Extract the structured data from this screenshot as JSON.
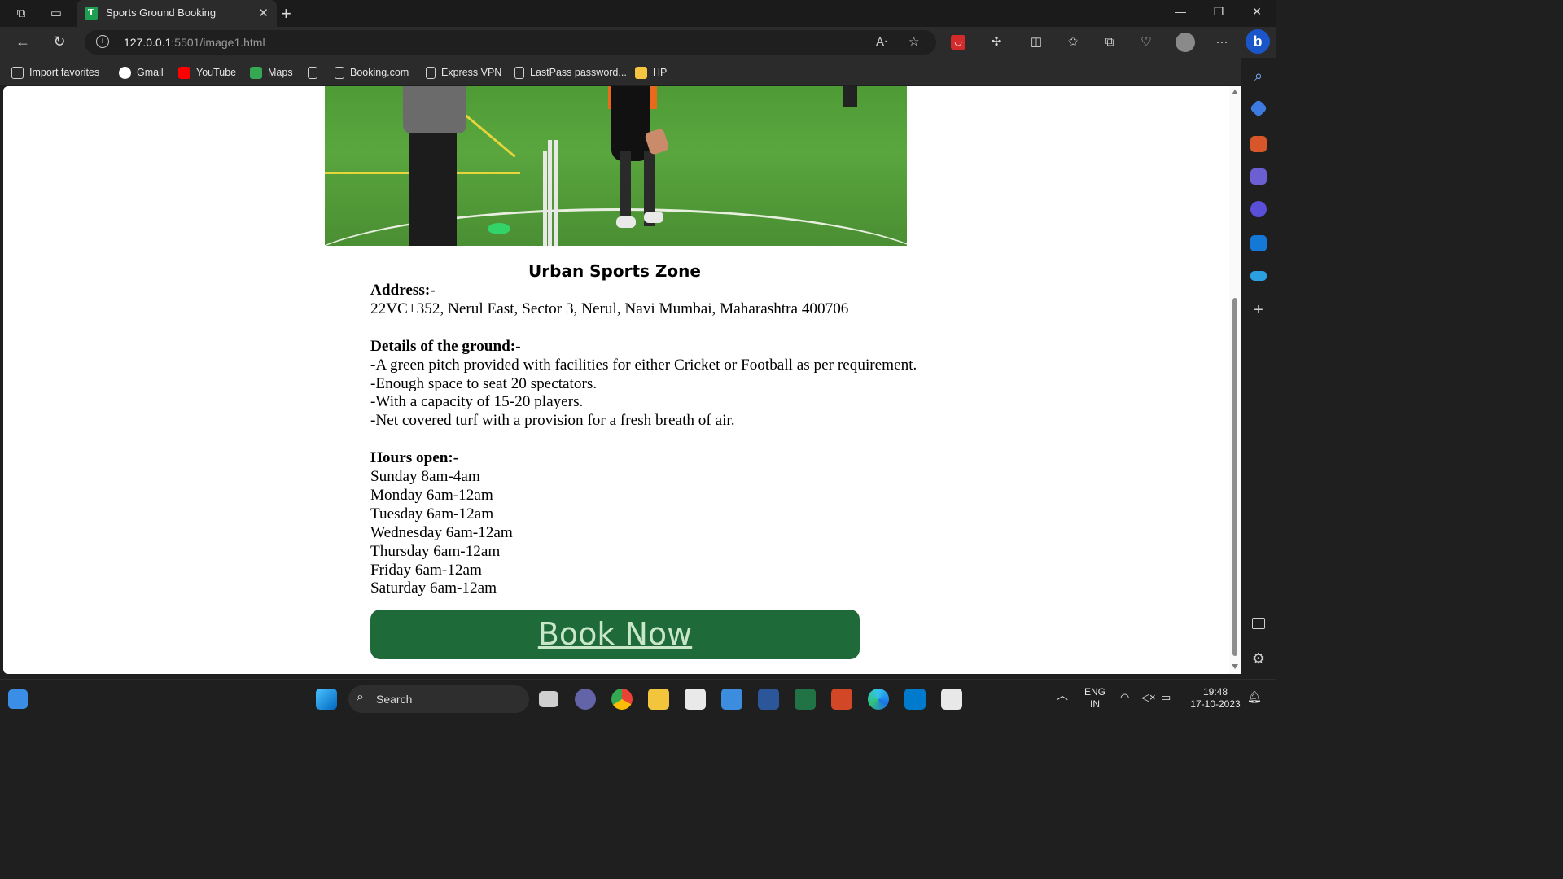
{
  "browser": {
    "tab_title": "Sports Ground Booking",
    "tab_favicon_letter": "T",
    "url_host": "127.0.0.1",
    "url_path": ":5501/image1.html"
  },
  "favorites": [
    {
      "label": "Import favorites",
      "icon": "import-icon",
      "color": "#cfcfcf"
    },
    {
      "label": "Gmail",
      "icon": "google-icon",
      "color": "#ffffff"
    },
    {
      "label": "YouTube",
      "icon": "youtube-icon",
      "color": "#ff0000"
    },
    {
      "label": "Maps",
      "icon": "maps-icon",
      "color": "#34a853"
    },
    {
      "label": "",
      "icon": "page-icon",
      "color": "#cfcfcf"
    },
    {
      "label": "Booking.com",
      "icon": "page-icon",
      "color": "#cfcfcf"
    },
    {
      "label": "Express VPN",
      "icon": "page-icon",
      "color": "#cfcfcf"
    },
    {
      "label": "LastPass password...",
      "icon": "page-icon",
      "color": "#cfcfcf"
    },
    {
      "label": "HP",
      "icon": "folder-icon",
      "color": "#f5c542"
    }
  ],
  "page": {
    "venue_name": "Urban Sports Zone",
    "address_heading": "Address:-",
    "address": "22VC+352, Nerul East, Sector 3, Nerul, Navi Mumbai, Maharashtra 400706",
    "details_heading": "Details of the ground:-",
    "details": [
      "-A green pitch provided with facilities for either Cricket or Football as per requirement.",
      "-Enough space to seat 20 spectators.",
      "-With a capacity of 15-20 players.",
      "-Net covered turf with a provision for a fresh breath of air."
    ],
    "hours_heading": "Hours open:-",
    "hours": [
      "Sunday 8am-4am",
      "Monday 6am-12am",
      "Tuesday 6am-12am",
      "Wednesday 6am-12am",
      "Thursday 6am-12am",
      "Friday 6am-12am",
      "Saturday 6am-12am"
    ],
    "book_button": "Book Now",
    "accent_color": "#1e6b39"
  },
  "taskbar": {
    "search_label": "Search",
    "lang_top": "ENG",
    "lang_bottom": "IN",
    "time": "19:48",
    "date": "17-10-2023"
  }
}
